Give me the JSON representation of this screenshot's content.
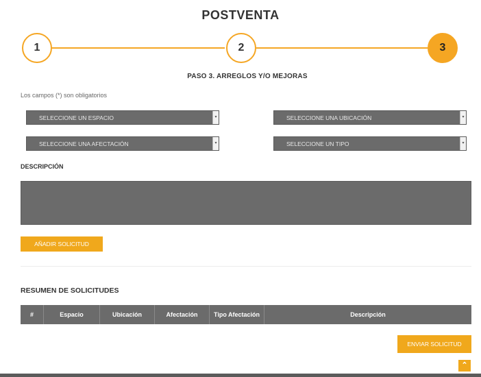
{
  "page": {
    "title": "POSTVENTA"
  },
  "steps": [
    {
      "label": "1"
    },
    {
      "label": "2"
    },
    {
      "label": "3"
    }
  ],
  "step_title": "PASO 3. ARREGLOS Y/O MEJORAS",
  "required_note": "Los campos (*) son obligatorios",
  "form": {
    "espacio_placeholder": "SELECCIONE UN ESPACIO",
    "ubicacion_placeholder": "SELECCIONE UNA UBICACIÓN",
    "afectacion_placeholder": "SELECCIONE UNA AFECTACIÓN",
    "tipo_placeholder": "SELECCIONE UN TIPO",
    "descripcion_label": "DESCRIPCIÓN",
    "descripcion_value": "",
    "add_button": "AÑADIR SOLICITUD"
  },
  "summary": {
    "title": "RESUMEN DE SOLICITUDES",
    "columns": [
      "#",
      "Espacio",
      "Ubicación",
      "Afectación",
      "Tipo Afectación",
      "Descripción"
    ],
    "rows": []
  },
  "send_button": "ENVIAR SOLICITUD",
  "scroll_top_icon": "chevron-up-icon",
  "colors": {
    "accent": "#f5a623",
    "field_bg": "#6b6b6b"
  }
}
